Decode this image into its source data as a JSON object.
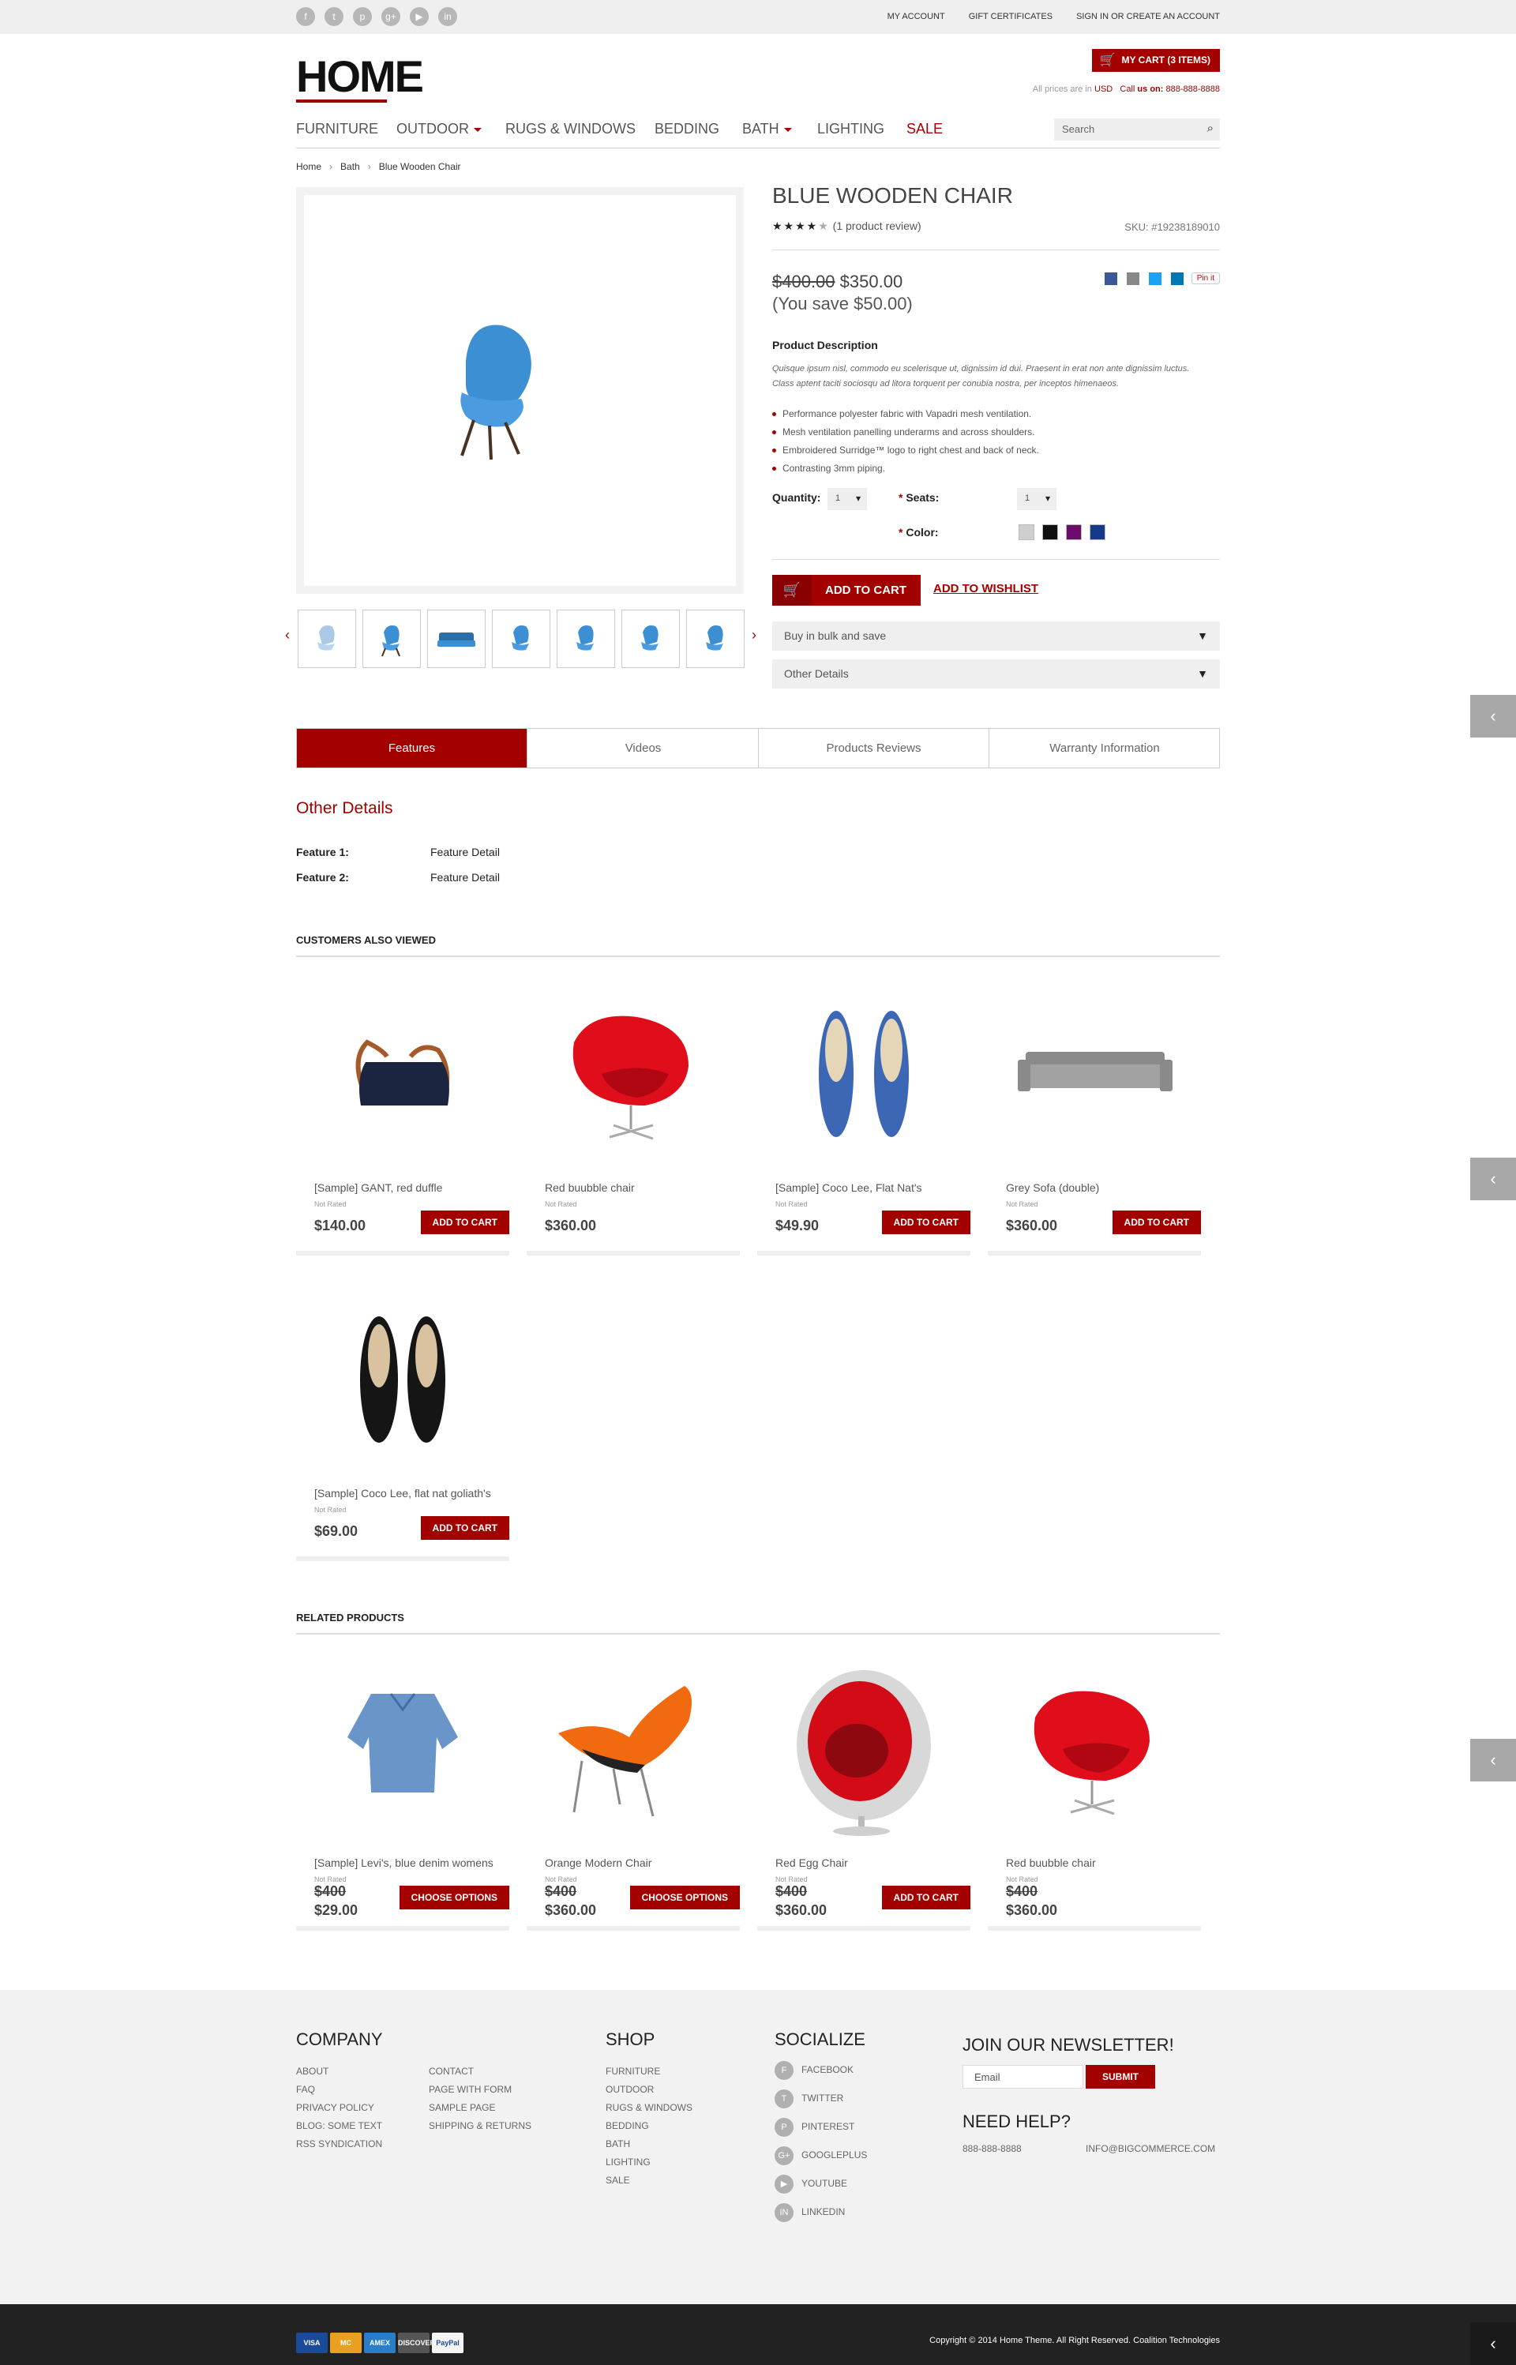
{
  "topbar": {
    "social_icons": [
      "facebook-icon",
      "twitter-icon",
      "pinterest-icon",
      "googleplus-icon",
      "youtube-icon",
      "linkedin-icon"
    ],
    "social_glyphs": [
      "f",
      "t",
      "p",
      "g+",
      "▶",
      "in"
    ],
    "links": [
      "MY ACCOUNT",
      "GIFT CERTIFICATES",
      "SIGN IN OR CREATE AN ACCOUNT"
    ]
  },
  "header": {
    "logo": "HOME",
    "cart_label": "MY CART (3 items)",
    "prices_prefix": "All prices are in",
    "currency": "USD",
    "call_prefix": "Call",
    "call_label": "us on:",
    "phone": "888-888-8888"
  },
  "nav": {
    "items": [
      "FURNITURE",
      "OUTDOOR",
      "RUGS & WINDOWS",
      "BEDDING",
      "BATH",
      "LIGHTING",
      "SALE"
    ],
    "search_placeholder": "Search"
  },
  "breadcrumb": [
    "Home",
    "Bath",
    "Blue Wooden Chair"
  ],
  "product": {
    "title": "BLUE WOODEN CHAIR",
    "stars": 4,
    "stars_max": 5,
    "review_text": "(1 product review)",
    "sku": "SKU: #19238189010",
    "old_price": "$400.00",
    "price": "$350.00",
    "save": "(You save $50.00)",
    "pinit": "Pin it",
    "desc_title": "Product Description",
    "desc": "Quisque ipsum nisl, commodo eu scelerisque ut, dignissim id dui. Praesent in erat non ante dignissim luctus. Class aptent taciti sociosqu ad litora torquent per conubia nostra, per inceptos himenaeos.",
    "bullets": [
      "Performance polyester fabric with Vapadri mesh ventilation.",
      "Mesh ventilation panelling underarms and across shoulders.",
      "Embroidered Surridge™ logo to right chest and back of neck.",
      "Contrasting 3mm piping."
    ],
    "quantity_label": "Quantity:",
    "quantity_value": "1",
    "seats_label": "Seats:",
    "seats_value": "1",
    "color_label": "Color:",
    "colors": [
      "#cfcfcf",
      "#111111",
      "#6b0d6b",
      "#163a8a"
    ],
    "add_to_cart": "ADD TO CART",
    "wishlist": "ADD TO WISHLIST",
    "accordions": [
      "Buy in bulk and save",
      "Other Details"
    ]
  },
  "tabs": [
    "Features",
    "Videos",
    "Products Reviews",
    "Warranty Information"
  ],
  "details": {
    "title": "Other Details",
    "rows": [
      {
        "k": "Feature 1:",
        "v": "Feature Detail"
      },
      {
        "k": "Feature 2:",
        "v": "Feature Detail"
      }
    ]
  },
  "also_viewed": {
    "title": "CUSTOMERS ALSO VIEWED",
    "items": [
      {
        "name": "[Sample] GANT, red duffle",
        "rating": "Not Rated",
        "price": "$140.00",
        "button": "ADD TO CART"
      },
      {
        "name": "Red buubble chair",
        "rating": "Not Rated",
        "price": "$360.00",
        "button": ""
      },
      {
        "name": "[Sample] Coco Lee, Flat Nat's",
        "rating": "Not Rated",
        "price": "$49.90",
        "button": "ADD TO CART"
      },
      {
        "name": "Grey Sofa (double)",
        "rating": "Not Rated",
        "price": "$360.00",
        "button": "ADD TO CART"
      },
      {
        "name": "[Sample] Coco Lee, flat nat goliath's",
        "rating": "Not Rated",
        "price": "$69.00",
        "button": "ADD TO CART"
      }
    ]
  },
  "related": {
    "title": "RELATED PRODUCTS",
    "items": [
      {
        "name": "[Sample] Levi's, blue denim womens",
        "rating": "Not Rated",
        "old": "$400",
        "price": "$29.00",
        "button": "CHOOSE OPTIONS"
      },
      {
        "name": "Orange Modern Chair",
        "rating": "Not Rated",
        "old": "$400",
        "price": "$360.00",
        "button": "CHOOSE OPTIONS"
      },
      {
        "name": "Red Egg Chair",
        "rating": "Not Rated",
        "old": "$400",
        "price": "$360.00",
        "button": "ADD TO CART"
      },
      {
        "name": "Red buubble chair",
        "rating": "Not Rated",
        "old": "$400",
        "price": "$360.00",
        "button": ""
      }
    ]
  },
  "footer": {
    "company": {
      "title": "COMPANY",
      "col1": [
        "ABOUT",
        "FAQ",
        "PRIVACY POLICY",
        "BLOG: SOME TEXT",
        "RSS SYNDICATION"
      ],
      "col2": [
        "CONTACT",
        "PAGE WITH FORM",
        "SAMPLE PAGE",
        "SHIPPING & RETURNS"
      ]
    },
    "shop": {
      "title": "SHOP",
      "items": [
        "FURNITURE",
        "OUTDOOR",
        "RUGS & WINDOWS",
        "BEDDING",
        "BATH",
        "LIGHTING",
        "SALE"
      ]
    },
    "socialize": {
      "title": "SOCIALIZE",
      "items": [
        "FACEBOOK",
        "TWITTER",
        "PINTEREST",
        "GOOGLEPLUS",
        "YOUTUBE",
        "LINKEDIN"
      ],
      "glyphs": [
        "f",
        "t",
        "p",
        "g+",
        "▶",
        "in"
      ]
    },
    "newsletter": {
      "title": "JOIN OUR NEWSLETTER!",
      "placeholder": "Email",
      "submit": "SUBMIT"
    },
    "help": {
      "title": "NEED HELP?",
      "phone": "888-888-8888",
      "email": "INFO@BIGCOMMERCE.COM"
    }
  },
  "bottom": {
    "cards": [
      "VISA",
      "MC",
      "AMEX",
      "DISCOVER",
      "PayPal"
    ],
    "copyright": "Copyright © 2014 Home Theme. All Right Reserved. Coalition Technologies"
  },
  "accent": "#a30000"
}
